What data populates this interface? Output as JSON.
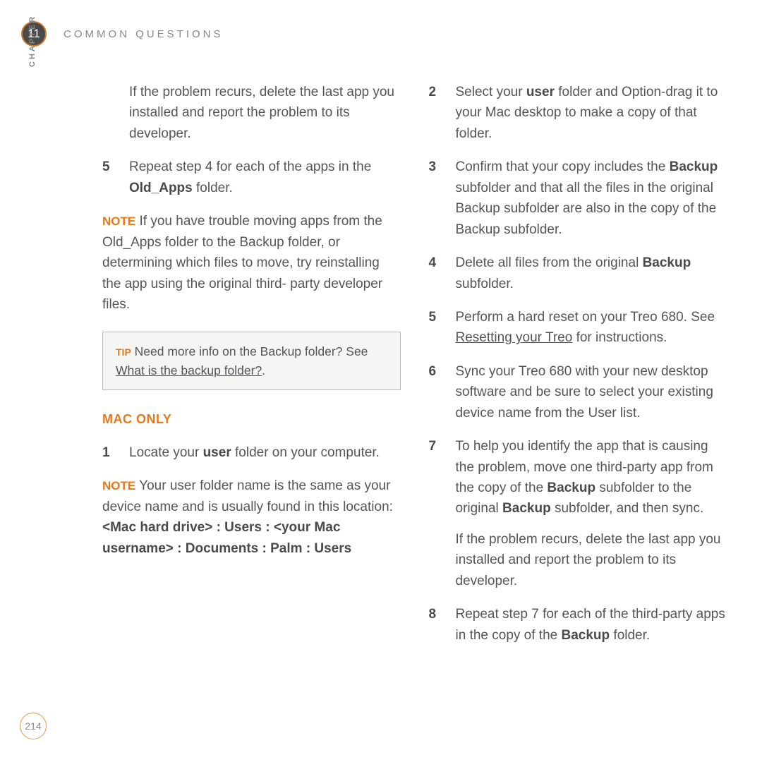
{
  "chapter": {
    "number": "11",
    "label": "CHAPTER",
    "title": "COMMON QUESTIONS"
  },
  "page_number": "214",
  "left_column": {
    "intro_para": "If the problem recurs, delete the last app you installed and report the problem to its developer.",
    "step5_num": "5",
    "step5_a": "Repeat step 4 for each of the apps in the ",
    "step5_bold": "Old_Apps",
    "step5_b": " folder.",
    "note1_label": "NOTE",
    "note1_text": " If you have trouble moving apps from the Old_Apps folder to the Backup folder, or determining which files to move, try reinstalling the app using the original third- party developer files.",
    "tip_label": "TIP",
    "tip_a": " Need more info on the Backup folder? See ",
    "tip_link": "What is the backup folder?",
    "tip_b": ".",
    "mac_heading": "MAC ONLY",
    "step1_num": "1",
    "step1_a": "Locate your ",
    "step1_bold": "user",
    "step1_b": " folder on your computer.",
    "note2_label": "NOTE",
    "note2_a": " Your user folder name is the same as your device name and is usually found in this location: ",
    "note2_bold": "<Mac hard drive> : Users : <your Mac username> : Documents : Palm : Users"
  },
  "right_column": {
    "step2_num": "2",
    "step2_a": "Select your ",
    "step2_bold": "user",
    "step2_b": " folder and Option-drag it to your Mac desktop to make a copy of that folder.",
    "step3_num": "3",
    "step3_a": "Confirm that your copy includes the ",
    "step3_bold": "Backup",
    "step3_b": " subfolder and that all the files in the original Backup subfolder are also in the copy of the Backup subfolder.",
    "step4_num": "4",
    "step4_a": "Delete all files from the original ",
    "step4_bold": "Backup",
    "step4_b": " subfolder.",
    "step5_num": "5",
    "step5_a": "Perform a hard reset on your Treo 680. See ",
    "step5_link": "Resetting your Treo",
    "step5_b": " for instructions.",
    "step6_num": "6",
    "step6_text": "Sync your Treo 680 with your new desktop software and be sure to select your existing device name from the User list.",
    "step7_num": "7",
    "step7_a": "To help you identify the app that is causing the problem, move one third-party app from the copy of the ",
    "step7_bold1": "Backup",
    "step7_b": " subfolder to the original ",
    "step7_bold2": "Backup",
    "step7_c": " subfolder, and then sync.",
    "step7_para2": "If the problem recurs, delete the last app you installed and report the problem to its developer.",
    "step8_num": "8",
    "step8_a": "Repeat step 7 for each of the third-party apps in the copy of the ",
    "step8_bold": "Backup",
    "step8_b": " folder."
  }
}
